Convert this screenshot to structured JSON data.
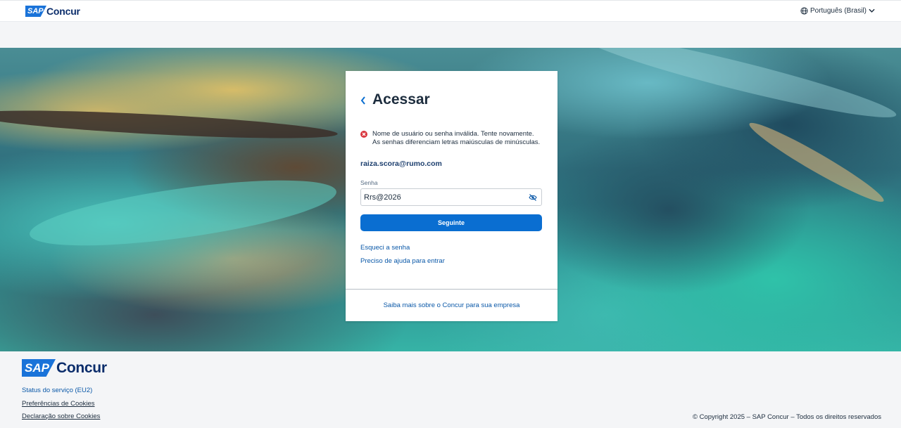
{
  "header": {
    "logo_sap": "SAP",
    "logo_concur": "Concur",
    "language": "Português (Brasil)"
  },
  "login": {
    "title": "Acessar",
    "error_line1": "Nome de usuário ou senha inválida. Tente novamente.",
    "error_line2": "As senhas diferenciam letras maiúsculas de minúsculas.",
    "email": "raiza.scora@rumo.com",
    "password_label": "Senha",
    "password_value": "Rrs@2026",
    "next_button": "Seguinte",
    "forgot_password": "Esqueci a senha",
    "need_help": "Preciso de ajuda para entrar",
    "learn_more": "Saiba mais sobre o Concur para sua empresa"
  },
  "footer": {
    "logo_sap": "SAP",
    "logo_concur": "Concur",
    "service_status": "Status do serviço (EU2)",
    "cookie_preferences": "Preferências de Cookies",
    "cookie_statement": "Declaração sobre Cookies",
    "copyright": "© Copyright 2025 – SAP Concur – Todos os direitos reservados"
  },
  "colors": {
    "primary_button": "#0a6ed1",
    "link": "#0a58a8",
    "error": "#d9363e",
    "brand_blue": "#1a73d9",
    "brand_navy": "#0b2d6b"
  },
  "icons": {
    "language": "globe-icon",
    "language_toggle": "chevron-down-icon",
    "back": "chevron-left-icon",
    "error": "error-circle-icon",
    "password_visibility": "eye-slash-icon"
  }
}
